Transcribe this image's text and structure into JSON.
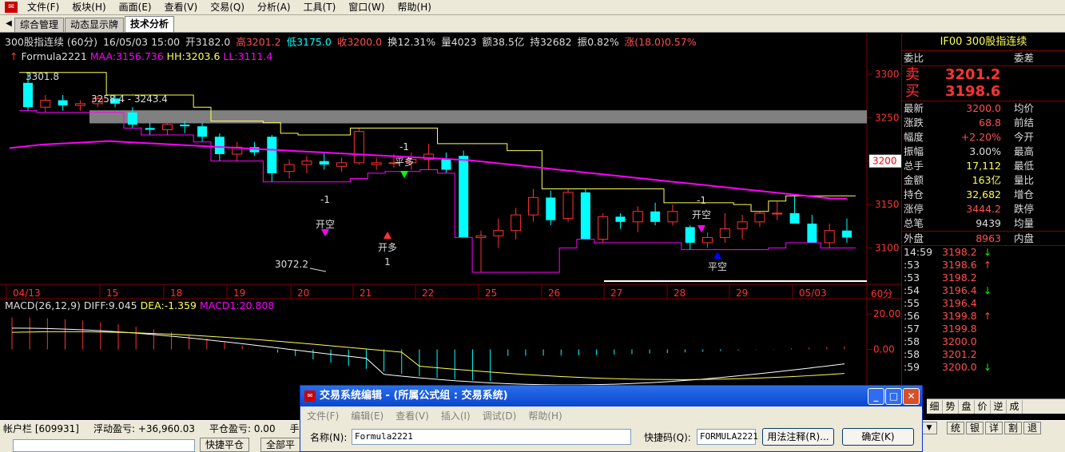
{
  "menu": {
    "items": [
      "文件(F)",
      "板块(H)",
      "画面(E)",
      "查看(V)",
      "交易(Q)",
      "分析(A)",
      "工具(T)",
      "窗口(W)",
      "帮助(H)"
    ]
  },
  "tabs": {
    "items": [
      "综合管理",
      "动态显示牌",
      "技术分析"
    ],
    "active_index": 2
  },
  "quote_header": {
    "title": "300股指连续 (60分)",
    "datetime": "16/05/03 15:00",
    "open": "开3182.0",
    "high": "高3201.2",
    "low": "低3175.0",
    "close": "收3200.0",
    "turnover": "换12.31%",
    "volume": "量4023",
    "amount": "额38.5亿",
    "open_interest": "持32682",
    "amplitude": "振0.82%",
    "change": "涨(18.0)0.57%"
  },
  "formula_line": {
    "name": "Formula2221",
    "maa": "MAA:3156.736",
    "hh": "HH:3203.6",
    "ll": "LL:3111.4"
  },
  "macd_line": {
    "name": "MACD(26,12,9)",
    "diff": "DIFF:9.045",
    "dea": "DEA:-1.359",
    "macd1": "MACD1:20.808"
  },
  "price_axis": {
    "ticks": [
      "3300",
      "3250",
      "3200",
      "3150",
      "3100"
    ],
    "current": "3200",
    "period_label": "60分"
  },
  "macd_axis": {
    "ticks": [
      "20.00",
      "0.00"
    ]
  },
  "date_axis": {
    "labels": [
      "04/13",
      "15",
      "18",
      "19",
      "20",
      "21",
      "22",
      "25",
      "26",
      "27",
      "28",
      "29",
      "05/03"
    ]
  },
  "annotations": {
    "high_label": "3301.8",
    "range_label": "3258.4 - 3243.4",
    "low_label": "3072.2",
    "signals": [
      {
        "action": "开空",
        "qty": "-1"
      },
      {
        "action": "开多",
        "qty": "1"
      },
      {
        "action": "平多",
        "qty": "-1"
      },
      {
        "action": "开空",
        "qty": "-1"
      },
      {
        "action": "平空",
        "qty": ""
      }
    ]
  },
  "chart_data": {
    "type": "candlestick",
    "title": "300股指连续 (60分)",
    "x": [
      "04/13",
      "04/13",
      "04/13",
      "04/13",
      "04/13",
      "04/13",
      "04/14",
      "04/14",
      "04/14",
      "04/14",
      "04/15",
      "04/15",
      "04/15",
      "04/15",
      "04/18",
      "04/18",
      "04/18",
      "04/18",
      "04/19",
      "04/19",
      "04/19",
      "04/19",
      "04/20",
      "04/20",
      "04/20",
      "04/20",
      "04/21",
      "04/21",
      "04/21",
      "04/21",
      "04/22",
      "04/22",
      "04/22",
      "04/22",
      "04/25",
      "04/25",
      "04/25",
      "04/25",
      "04/26",
      "04/26",
      "04/26",
      "04/26",
      "04/27",
      "04/27",
      "04/27",
      "04/27",
      "04/28",
      "04/28",
      "04/28",
      "04/28",
      "04/29",
      "04/29",
      "04/29",
      "04/29",
      "05/03",
      "05/03",
      "05/03"
    ],
    "series": [
      {
        "ohlc": [
          [
            3290,
            3302,
            3258,
            3262
          ],
          [
            3262,
            3276,
            3256,
            3270
          ],
          [
            3270,
            3276,
            3258,
            3264
          ],
          [
            3264,
            3270,
            3258,
            3266
          ],
          [
            3266,
            3275,
            3262,
            3272
          ],
          [
            3272,
            3276,
            3262,
            3266
          ],
          [
            3256,
            3262,
            3238,
            3242
          ],
          [
            3238,
            3244,
            3230,
            3236
          ],
          [
            3236,
            3246,
            3230,
            3242
          ],
          [
            3242,
            3246,
            3232,
            3240
          ],
          [
            3240,
            3244,
            3222,
            3228
          ],
          [
            3228,
            3232,
            3200,
            3208
          ],
          [
            3208,
            3222,
            3200,
            3216
          ],
          [
            3216,
            3222,
            3206,
            3210
          ],
          [
            3228,
            3230,
            3176,
            3186
          ],
          [
            3188,
            3202,
            3180,
            3196
          ],
          [
            3196,
            3206,
            3186,
            3200
          ],
          [
            3200,
            3210,
            3190,
            3196
          ],
          [
            3194,
            3204,
            3188,
            3198
          ],
          [
            3198,
            3238,
            3196,
            3234
          ],
          [
            3196,
            3204,
            3190,
            3198
          ],
          [
            3198,
            3208,
            3192,
            3198
          ],
          [
            3198,
            3210,
            3190,
            3202
          ],
          [
            3202,
            3220,
            3190,
            3208
          ],
          [
            3202,
            3210,
            3186,
            3190
          ],
          [
            3206,
            3212,
            3112,
            3112
          ],
          [
            3112,
            3120,
            3072,
            3114
          ],
          [
            3114,
            3134,
            3100,
            3120
          ],
          [
            3120,
            3146,
            3110,
            3138
          ],
          [
            3138,
            3168,
            3130,
            3158
          ],
          [
            3158,
            3166,
            3126,
            3132
          ],
          [
            3134,
            3168,
            3130,
            3164
          ],
          [
            3164,
            3168,
            3110,
            3110
          ],
          [
            3110,
            3140,
            3106,
            3136
          ],
          [
            3136,
            3140,
            3122,
            3130
          ],
          [
            3130,
            3148,
            3118,
            3142
          ],
          [
            3142,
            3152,
            3126,
            3130
          ],
          [
            3130,
            3150,
            3126,
            3142
          ],
          [
            3124,
            3126,
            3098,
            3106
          ],
          [
            3106,
            3118,
            3100,
            3112
          ],
          [
            3112,
            3140,
            3106,
            3122
          ],
          [
            3122,
            3138,
            3110,
            3130
          ],
          [
            3130,
            3142,
            3124,
            3140
          ],
          [
            3140,
            3154,
            3132,
            3140
          ],
          [
            3140,
            3160,
            3128,
            3128
          ],
          [
            3128,
            3138,
            3106,
            3106
          ],
          [
            3106,
            3128,
            3100,
            3120
          ],
          [
            3120,
            3134,
            3106,
            3112
          ]
        ]
      },
      {
        "name": "MAA",
        "values": [
          3215,
          3217,
          3219,
          3220,
          3221,
          3222,
          3223,
          3222,
          3221,
          3220,
          3219,
          3218,
          3217,
          3216,
          3215,
          3214,
          3213,
          3212,
          3211,
          3210,
          3209,
          3208,
          3207,
          3206,
          3205,
          3204,
          3203,
          3202,
          3201,
          3199,
          3197,
          3195,
          3193,
          3191,
          3189,
          3187,
          3185,
          3183,
          3181,
          3179,
          3177,
          3175,
          3173,
          3171,
          3169,
          3167,
          3165,
          3163,
          3161,
          3159,
          3157,
          3156.736
        ]
      },
      {
        "name": "HH",
        "values": [
          3203.6
        ]
      },
      {
        "name": "LL",
        "values": [
          3111.4
        ]
      },
      {
        "name": "DIFF",
        "values": [
          9.045
        ]
      },
      {
        "name": "DEA",
        "values": [
          -1.359
        ]
      },
      {
        "name": "MACD1",
        "values": [
          20.808
        ]
      }
    ],
    "ylim": [
      3060,
      3310
    ],
    "grid": false
  },
  "right_panel": {
    "title": "IF00  300股指连续",
    "weibi_label": "委比",
    "weicha_label": "委差",
    "sell_label": "卖",
    "sell_price": "3201.2",
    "buy_label": "买",
    "buy_price": "3198.6",
    "rows": [
      {
        "k1": "最新",
        "v1": "3200.0",
        "k2": "均价",
        "c": "#ff5050"
      },
      {
        "k1": "涨跌",
        "v1": "68.8",
        "k2": "前结",
        "c": "#ff5050"
      },
      {
        "k1": "幅度",
        "v1": "+2.20%",
        "k2": "今开",
        "c": "#ff5050"
      },
      {
        "k1": "振幅",
        "v1": "3.00%",
        "k2": "最高",
        "c": "#dddddd"
      },
      {
        "k1": "总手",
        "v1": "17,112",
        "k2": "最低",
        "c": "#ffff54"
      },
      {
        "k1": "金额",
        "v1": "163亿",
        "k2": "量比",
        "c": "#ffff54"
      },
      {
        "k1": "持仓",
        "v1": "32,682",
        "k2": "增仓",
        "c": "#ffff54"
      },
      {
        "k1": "涨停",
        "v1": "3444.2",
        "k2": "跌停",
        "c": "#ff5050"
      },
      {
        "k1": "总笔",
        "v1": "9439",
        "k2": "均量",
        "c": "#dddddd"
      }
    ],
    "outer_label": "外盘",
    "outer_value": "8963",
    "inner_label": "内盘",
    "ticks": [
      {
        "t": "14:59",
        "p": "3198.2",
        "a": "↓"
      },
      {
        "t": ":53",
        "p": "3198.6",
        "a": "↑"
      },
      {
        "t": ":53",
        "p": "3198.2",
        "a": ""
      },
      {
        "t": ":54",
        "p": "3196.4",
        "a": "↓"
      },
      {
        "t": ":55",
        "p": "3196.4",
        "a": ""
      },
      {
        "t": ":56",
        "p": "3199.8",
        "a": "↑"
      },
      {
        "t": ":57",
        "p": "3199.8",
        "a": ""
      },
      {
        "t": ":58",
        "p": "3200.0",
        "a": ""
      },
      {
        "t": ":58",
        "p": "3201.2",
        "a": ""
      },
      {
        "t": ":59",
        "p": "3200.0",
        "a": "↓"
      }
    ]
  },
  "side_tabs": [
    "细",
    "势",
    "盘",
    "价",
    "逆",
    "成"
  ],
  "status": {
    "account": "帐户栏 [609931]",
    "float_pnl": "浮动盈亏: +36,960.03",
    "close_pnl": "平仓盈亏: 0.00",
    "fee": "手续"
  },
  "status_buttons": [
    "统",
    "银",
    "详",
    "割",
    "退"
  ],
  "bottom": {
    "quick_close": "快捷平仓",
    "close_all": "全部平"
  },
  "dialog": {
    "title": "交易系统编辑 - (所属公式组 : 交易系统)",
    "menu": [
      "文件(F)",
      "编辑(E)",
      "查看(V)",
      "插入(I)",
      "调试(D)",
      "帮助(H)"
    ],
    "name_label": "名称(N):",
    "name_value": "Formula2221",
    "shortcut_label": "快捷码(Q):",
    "shortcut_value": "FORMULA2221",
    "syntax_button": "用法注释(R)...",
    "ok_button": "确定(K)"
  },
  "colors": {
    "up": "#ff3333",
    "down": "#00ffff",
    "maa": "#ff00ff",
    "hh": "#ffff54",
    "ll": "#ff00ff",
    "frame": "#800000",
    "band": "#808080"
  }
}
